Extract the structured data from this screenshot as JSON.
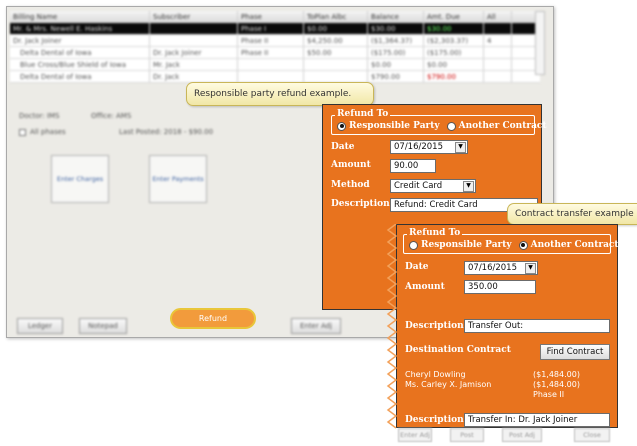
{
  "grid": {
    "headers": [
      "Billing Name",
      "Subscriber",
      "Phase",
      "ToPlan Albc",
      "Balance",
      "Amt. Due",
      "All"
    ],
    "rows": [
      [
        "Mr. & Mrs. Newell E. Haskins",
        "",
        "Phase I",
        "$0.00",
        "$30.00",
        "$30.00",
        ""
      ],
      [
        "Dr. Jack Joiner",
        "",
        "Phase II",
        "$4,250.00",
        "($1,364.37)",
        "($2,303.37)",
        "4"
      ],
      [
        "Delta Dental of Iowa",
        "Dr. Jack Joiner",
        "Phase II",
        "$50.00",
        "($175.00)",
        "($175.00)",
        ""
      ],
      [
        "Blue Cross/Blue Shield of Iowa",
        "Mr. Jack",
        "",
        "",
        "$0.00",
        "$0.00",
        ""
      ],
      [
        "Delta Dental of Iowa",
        "Dr. Jack",
        "",
        "",
        "$790.00",
        "$790.00",
        ""
      ]
    ]
  },
  "info": {
    "doctor": "Doctor: IMS",
    "office": "Office: AMS",
    "all_phases": "All phases",
    "last_posted": "Last Posted: 2018 - $90.00"
  },
  "actions": {
    "enter_charges": "Enter Charges",
    "enter_payments": "Enter Payments"
  },
  "bottom_buttons": {
    "ledger": "Ledger",
    "notepad": "Notepad",
    "refund": "Refund",
    "enter_adj": "Enter Adj",
    "post": "Post",
    "post_adj": "Post Adj",
    "close": "Close"
  },
  "callout_refund": "Responsible party refund example.",
  "callout_transfer": "Contract transfer example",
  "refund_dialog": {
    "group_label": "Refund To",
    "option_responsible": "Responsible Party",
    "option_contract": "Another Contract",
    "date_label": "Date",
    "date_value": "07/16/2015",
    "amount_label": "Amount",
    "amount_value": "90.00",
    "method_label": "Method",
    "method_value": "Credit Card",
    "description_label": "Description",
    "description_value": "Refund: Credit Card"
  },
  "transfer_dialog": {
    "group_label": "Refund To",
    "option_responsible": "Responsible Party",
    "option_contract": "Another Contract",
    "date_label": "Date",
    "date_value": "07/16/2015",
    "amount_label": "Amount",
    "amount_value": "350.00",
    "description_out_label": "Description",
    "description_out_value": "Transfer Out:",
    "destination_label": "Destination Contract",
    "find_contract": "Find Contract",
    "contract_name": "Cheryl Dowling",
    "contract_name_amount": "($1,484.00)",
    "contract_subscriber": "Ms. Carley X. Jamison",
    "contract_subscriber_amount": "($1,484.00)",
    "contract_phase": "Phase II",
    "description_in_label": "Description",
    "description_in_value": "Transfer In: Dr. Jack Joiner"
  },
  "colors": {
    "dialog_orange": "#e8731e",
    "callout_bg": "#fff7cf",
    "highlight_ring": "#e9c63a"
  }
}
